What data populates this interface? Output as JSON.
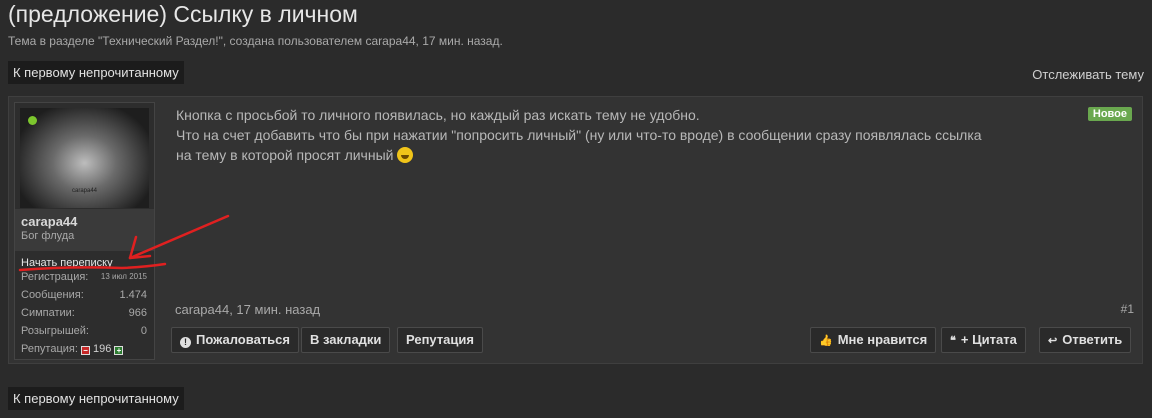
{
  "thread": {
    "title": "(предложение) Ссылку в личном",
    "subtitle": "Тема в разделе \"Технический Раздел!\", создана пользователем carapa44, 17 мин. назад."
  },
  "nav": {
    "first_unread": "К первому непрочитанному",
    "watch": "Отслеживать тему"
  },
  "user": {
    "avatar_text": "carapa44",
    "name": "carapa44",
    "title": "Бог флуда",
    "start_pm": "Начать переписку",
    "stats": [
      {
        "label": "Регистрация:",
        "value": "13 июл 2015"
      },
      {
        "label": "Сообщения:",
        "value": "1.474"
      },
      {
        "label": "Симпатии:",
        "value": "966"
      },
      {
        "label": "Розыгрышей:",
        "value": "0"
      }
    ],
    "reputation_label": "Репутация:",
    "reputation_value": "196"
  },
  "post": {
    "lines": [
      "Кнопка с просьбой то личного появилась, но каждый раз искать тему не удобно.",
      "Что на счет добавить что бы при нажатии \"попросить личный\" (ну или что-то вроде) в сообщении сразу появлялась ссылка",
      "на тему в которой просят личный"
    ],
    "badge": "Новое",
    "meta": "carapa44, 17 мин. назад",
    "number": "#1"
  },
  "actions": {
    "report": "Пожаловаться",
    "bookmark": "В закладки",
    "reputation": "Репутация",
    "like": "Мне нравится",
    "quote": "+ Цитата",
    "reply": "Ответить"
  },
  "colors": {
    "background": "#2b2b2b",
    "badge": "#6aa84f",
    "annotation": "#e02020"
  }
}
